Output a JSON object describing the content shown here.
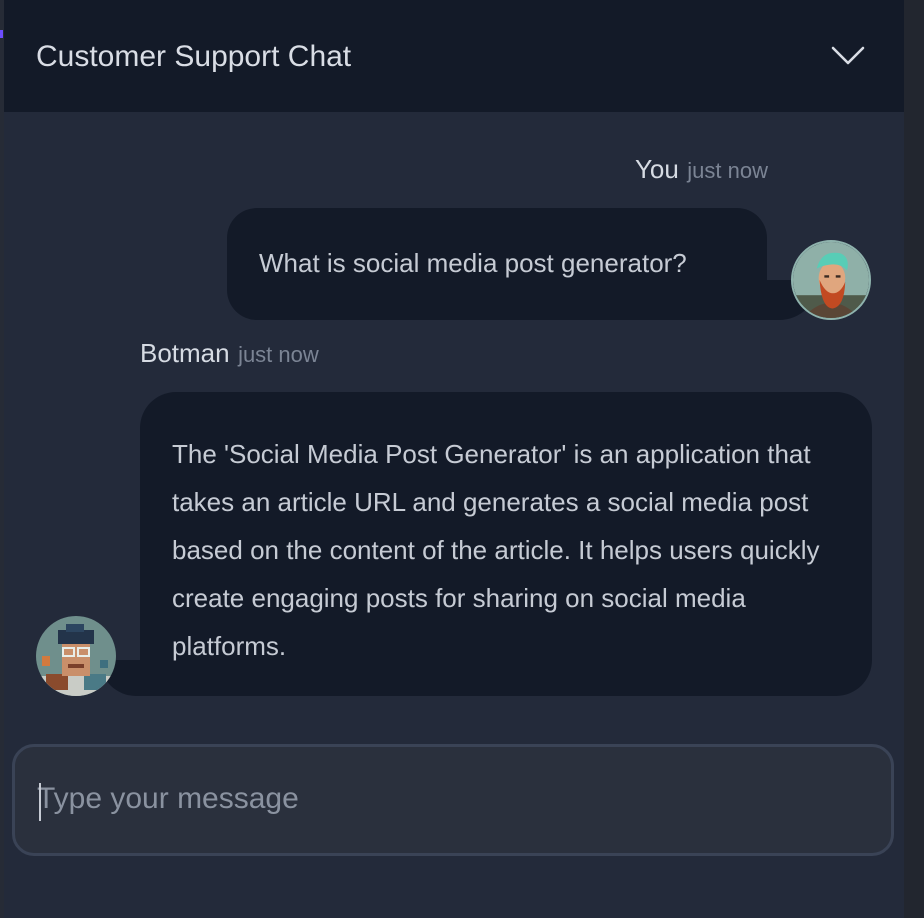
{
  "header": {
    "title": "Customer Support Chat",
    "collapse_icon": "chevron-down-icon"
  },
  "messages": [
    {
      "author": "You",
      "time": "just now",
      "text": "What is social media post generator?",
      "avatar_icon": "user-avatar"
    },
    {
      "author": "Botman",
      "time": "just now",
      "text": "The 'Social Media Post Generator' is an application that takes an article URL and generates a social media post based on the content of the article. It helps users quickly create engaging posts for sharing on social media platforms.",
      "avatar_icon": "bot-avatar"
    }
  ],
  "composer": {
    "placeholder": "Type your message",
    "value": ""
  },
  "colors": {
    "header_bg": "#131a28",
    "panel_bg": "#232a3a",
    "bubble_bg": "#131a28",
    "input_bg": "#2a303d",
    "accent": "#6d4dff"
  }
}
